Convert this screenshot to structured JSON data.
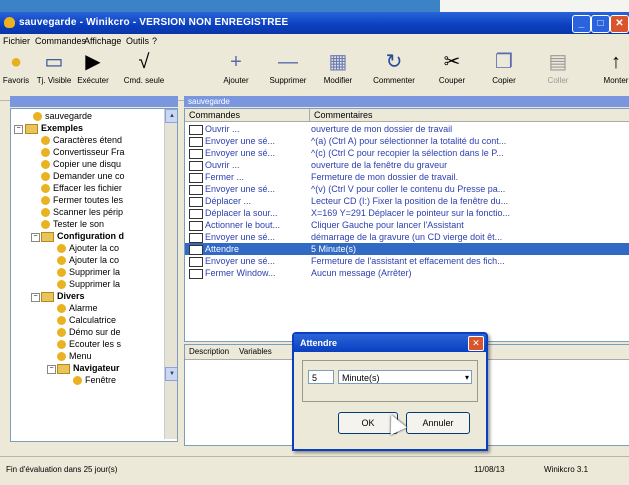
{
  "window": {
    "title": "sauvegarde - Winikcro - VERSION NON ENREGISTREE"
  },
  "menu": [
    "Fichier",
    "Commandes",
    "Affichage",
    "Outils",
    "?"
  ],
  "toolbar": [
    {
      "label": "Favoris",
      "icon": "favorites-icon"
    },
    {
      "label": "Tj. Visible",
      "icon": "window-icon"
    },
    {
      "label": "Exécuter",
      "icon": "play-icon"
    },
    {
      "label": "Cmd. seule",
      "icon": "check-icon"
    },
    {
      "label": "Ajouter",
      "icon": "plus-icon"
    },
    {
      "label": "Supprimer",
      "icon": "minus-icon"
    },
    {
      "label": "Modifier",
      "icon": "edit-icon"
    },
    {
      "label": "Commenter",
      "icon": "comment-icon"
    },
    {
      "label": "Couper",
      "icon": "scissors-icon"
    },
    {
      "label": "Copier",
      "icon": "copy-icon"
    },
    {
      "label": "Coller",
      "icon": "paste-icon"
    },
    {
      "label": "Monter",
      "icon": "up-icon"
    }
  ],
  "panels": {
    "list_header": "sauvegarde"
  },
  "tree": [
    {
      "label": "sauvegarde",
      "level": 1,
      "type": "shortcut"
    },
    {
      "label": "Exemples",
      "level": 0,
      "type": "folder",
      "bold": true
    },
    {
      "label": "Caractères étend",
      "level": 2,
      "type": "shortcut"
    },
    {
      "label": "Convertisseur Fra",
      "level": 2,
      "type": "shortcut"
    },
    {
      "label": "Copier une disqu",
      "level": 2,
      "type": "shortcut"
    },
    {
      "label": "Demander une co",
      "level": 2,
      "type": "shortcut"
    },
    {
      "label": "Effacer les fichier",
      "level": 2,
      "type": "shortcut"
    },
    {
      "label": "Fermer toutes les",
      "level": 2,
      "type": "shortcut"
    },
    {
      "label": "Scanner les périp",
      "level": 2,
      "type": "shortcut"
    },
    {
      "label": "Tester le son",
      "level": 2,
      "type": "shortcut"
    },
    {
      "label": "Configuration d",
      "level": 1,
      "type": "folder",
      "bold": true
    },
    {
      "label": "Ajouter la co",
      "level": 3,
      "type": "shortcut"
    },
    {
      "label": "Ajouter la co",
      "level": 3,
      "type": "shortcut"
    },
    {
      "label": "Supprimer la",
      "level": 3,
      "type": "shortcut"
    },
    {
      "label": "Supprimer la",
      "level": 3,
      "type": "shortcut"
    },
    {
      "label": "Divers",
      "level": 1,
      "type": "folder",
      "bold": true
    },
    {
      "label": "Alarme",
      "level": 3,
      "type": "shortcut"
    },
    {
      "label": "Calculatrice",
      "level": 3,
      "type": "shortcut"
    },
    {
      "label": "Démo sur de",
      "level": 3,
      "type": "shortcut"
    },
    {
      "label": "Ecouter les s",
      "level": 3,
      "type": "shortcut"
    },
    {
      "label": "Menu",
      "level": 3,
      "type": "shortcut"
    },
    {
      "label": "Navigateur",
      "level": 2,
      "type": "folder",
      "bold": true
    },
    {
      "label": "Fenêtre",
      "level": 4,
      "type": "shortcut"
    }
  ],
  "list": {
    "columns": [
      "Commandes",
      "Commentaires"
    ],
    "rows": [
      {
        "cmd": "Ouvrir ...",
        "comment": "ouverture de mon dossier de travail"
      },
      {
        "cmd": "Envoyer une sé...",
        "comment": "^(a) (Ctrl A) pour sélectionner la totalité du cont..."
      },
      {
        "cmd": "Envoyer une sé...",
        "comment": "^(c) (Ctrl C pour recopier la sélection dans le P..."
      },
      {
        "cmd": "Ouvrir ...",
        "comment": "ouverture de la fenêtre du graveur"
      },
      {
        "cmd": "Fermer ...",
        "comment": "Fermeture de mon dossier de travail."
      },
      {
        "cmd": "Envoyer une sé...",
        "comment": "^(v) (Ctrl V pour coller le contenu du Presse pa..."
      },
      {
        "cmd": "Déplacer ...",
        "comment": "Lecteur CD (I:) Fixer la position de la fenêtre du..."
      },
      {
        "cmd": "Déplacer la sour...",
        "comment": "X=169 Y=291 Déplacer le pointeur sur la fonctio..."
      },
      {
        "cmd": "Actionner le bout...",
        "comment": "Cliquer Gauche pour lancer l'Assistant"
      },
      {
        "cmd": "Envoyer une sé...",
        "comment": "démarrage de la gravure (un CD vierge doit êt..."
      },
      {
        "cmd": "Attendre",
        "comment": "5 Minute(s)",
        "selected": true
      },
      {
        "cmd": "Envoyer une sé...",
        "comment": "Fermeture de l'assistant et effacement des fich..."
      },
      {
        "cmd": "Fermer Window...",
        "comment": "Aucun message (Arrêter)"
      }
    ]
  },
  "lower_tabs": [
    "Description",
    "Variables"
  ],
  "status": {
    "left": "Fin d'évaluation dans 25 jour(s)",
    "date": "11/08/13",
    "version": "Winikcro 3.1"
  },
  "dialog": {
    "title": "Attendre",
    "value": "5",
    "unit": "Minute(s)",
    "ok": "OK",
    "cancel": "Annuler"
  }
}
